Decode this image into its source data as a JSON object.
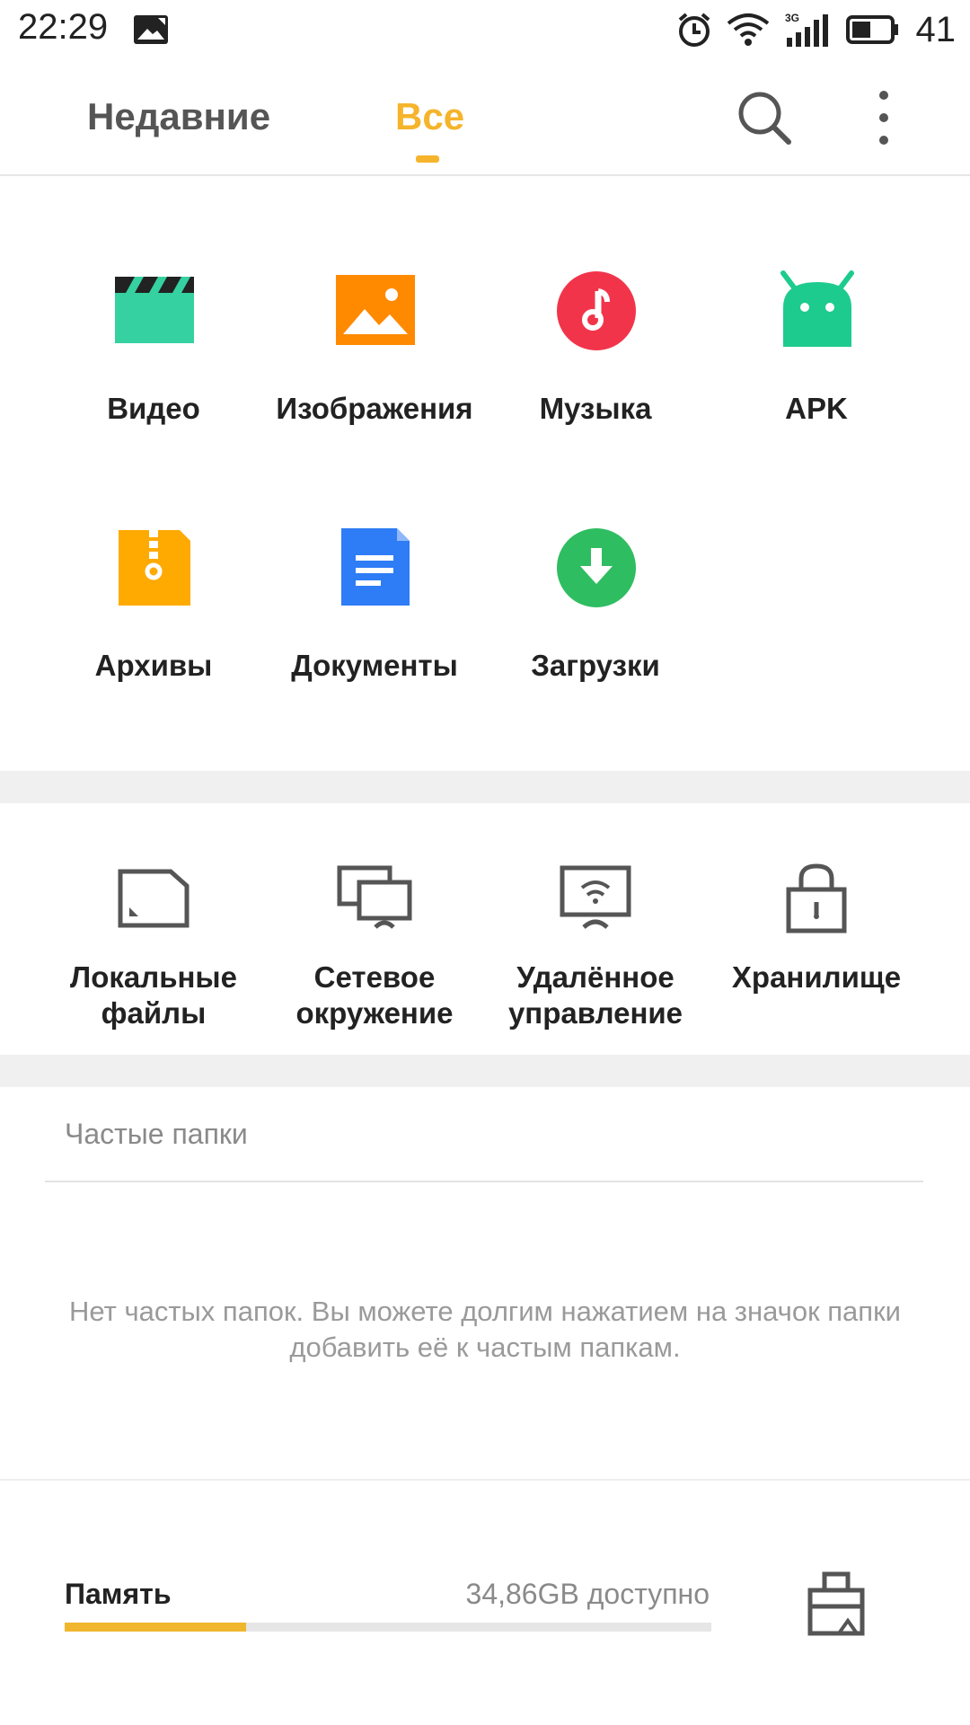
{
  "status_bar": {
    "time": "22:29",
    "network": "3G",
    "battery_percent": "41"
  },
  "top_bar": {
    "tabs": [
      {
        "label": "Недавние",
        "active": false
      },
      {
        "label": "Все",
        "active": true
      }
    ],
    "accent_color": "#f5b42c"
  },
  "categories": [
    {
      "label": "Видео",
      "icon": "video-clapper-icon",
      "color": "#35d1a0"
    },
    {
      "label": "Изображения",
      "icon": "image-icon",
      "color": "#ff8a00"
    },
    {
      "label": "Музыка",
      "icon": "music-note-icon",
      "color": "#f2344a"
    },
    {
      "label": "APK",
      "icon": "android-icon",
      "color": "#1ecb8e"
    },
    {
      "label": "Архивы",
      "icon": "archive-zip-icon",
      "color": "#ffaa00"
    },
    {
      "label": "Документы",
      "icon": "document-icon",
      "color": "#2e7cf6"
    },
    {
      "label": "Загрузки",
      "icon": "download-icon",
      "color": "#2fbd61"
    }
  ],
  "tools": [
    {
      "label": "Локальные файлы",
      "icon": "sd-card-icon"
    },
    {
      "label": "Сетевое окружение",
      "icon": "network-screens-icon"
    },
    {
      "label": "Удалённое управление",
      "icon": "remote-wifi-monitor-icon"
    },
    {
      "label": "Хранилище",
      "icon": "lock-icon"
    }
  ],
  "frequent_folders": {
    "title": "Частые папки",
    "empty_text": "Нет частых папок. Вы можете долгим нажатием на значок папки добавить её к частым папкам."
  },
  "storage": {
    "label": "Память",
    "free_text": "34,86GB доступно",
    "used_fraction": 0.28,
    "bar_color": "#f0b62e",
    "clean_icon": "broom-clean-icon"
  }
}
